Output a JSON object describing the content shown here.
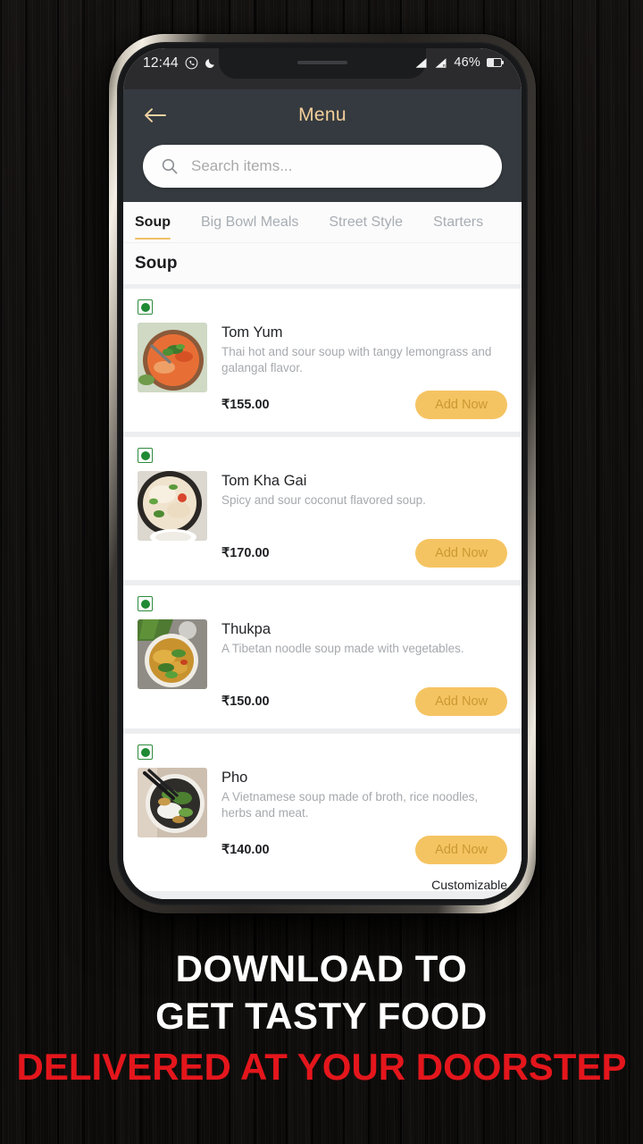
{
  "background": {
    "style": "dark-wood",
    "color": "#0c0b0a"
  },
  "status_bar": {
    "time": "12:44",
    "whatsapp_icon": "whatsapp-icon",
    "dnd_icon": "crescent-moon-icon",
    "signal_icon_1": "signal-bars-icon",
    "signal_icon_2": "signal-bars-roaming-icon",
    "battery_percent": "46%",
    "battery_icon": "battery-icon"
  },
  "app_bar": {
    "back_icon": "back-arrow-icon",
    "title": "Menu",
    "title_color": "#f3cf9a",
    "background": "#343a3f"
  },
  "search": {
    "icon": "search-icon",
    "placeholder": "Search items...",
    "value": ""
  },
  "tabs": {
    "active_index": 0,
    "items": [
      {
        "label": "Soup"
      },
      {
        "label": "Big Bowl Meals"
      },
      {
        "label": "Street Style"
      },
      {
        "label": "Starters"
      }
    ],
    "indicator_color": "#efc066"
  },
  "section": {
    "title": "Soup"
  },
  "menu_items": [
    {
      "veg_marker": "veg-indicator-icon",
      "thumb": "tom-yum-soup-photo",
      "name": "Tom Yum",
      "description": "Thai hot and sour soup with tangy lemongrass and galangal flavor.",
      "price": "₹155.00",
      "add_label": "Add Now",
      "customizable": ""
    },
    {
      "veg_marker": "veg-indicator-icon",
      "thumb": "tom-kha-gai-soup-photo",
      "name": "Tom Kha Gai",
      "description": "Spicy and sour coconut flavored soup.",
      "price": "₹170.00",
      "add_label": "Add Now",
      "customizable": ""
    },
    {
      "veg_marker": "veg-indicator-icon",
      "thumb": "thukpa-noodle-soup-photo",
      "name": "Thukpa",
      "description": "A Tibetan noodle soup made with vegetables.",
      "price": "₹150.00",
      "add_label": "Add Now",
      "customizable": ""
    },
    {
      "veg_marker": "veg-indicator-icon",
      "thumb": "pho-soup-photo",
      "name": "Pho",
      "description": "A Vietnamese soup made of broth, rice noodles, herbs and meat.",
      "price": "₹140.00",
      "add_label": "Add Now",
      "customizable": "Customizable"
    }
  ],
  "promo": {
    "line1": "DOWNLOAD TO",
    "line2": "GET TASTY FOOD",
    "line3": "DELIVERED AT YOUR DOORSTEP",
    "line1_color": "#ffffff",
    "line3_color": "#e4161c"
  },
  "theme": {
    "accent": "#f5c462",
    "header_bg": "#343a3f",
    "veg_green": "#1f8a33"
  }
}
